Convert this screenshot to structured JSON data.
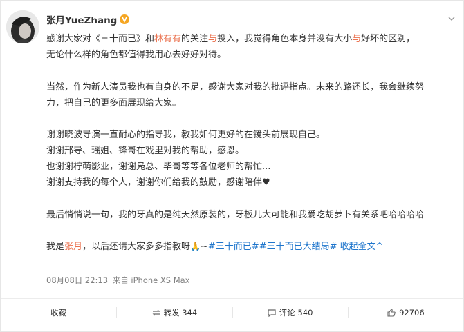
{
  "user": {
    "name": "张月YueZhang"
  },
  "post": {
    "line1": {
      "t1": "感谢大家对《三十而已》和",
      "name": "林有有",
      "t2": "的关注",
      "and": "与",
      "t3": "投入，我觉得角色本身并没有大小",
      "and2": "与",
      "t4": "好坏的区别，"
    },
    "line2": "无论什么样的角色都值得我用心去好好对待。",
    "line3": "当然，作为新人演员我也有自身的不足，感谢大家对我的批评指点。未来的路还长，我会继续努",
    "line4": "力，把自己的更多面展现给大家。",
    "line5": "谢谢晓波导演一直耐心的指导我，教我如何更好的在镜头前展现自己。",
    "line6": "谢谢邢导、瑶姐、锋哥在戏里对我的帮助，感恩。",
    "line7": "也谢谢柠萌影业，谢谢凫总、毕哥等等各位老师的帮忙...",
    "line8": "谢谢支持我的每个人，谢谢你们给我的鼓励，感谢陪伴",
    "line8_heart": "♥",
    "line9": "最后悄悄说一句，我的牙真的是纯天然原装的，牙板儿大可能和我爱吃胡萝卜有关系吧哈哈哈哈",
    "line10": {
      "t1": "我是",
      "name": "张月",
      "t2": "，以后还请大家多多指教呀",
      "pray": "🙏",
      "tilde": "~",
      "tag1": "#三十而已#",
      "tag2": "#三十而已大结局#",
      "expand": "收起全文",
      "expand_arrow": "^"
    }
  },
  "meta": {
    "date": "08月08日 22:13",
    "source": "来自 iPhone XS Max"
  },
  "actions": {
    "favorite": "收藏",
    "repost": "转发 344",
    "comment": "评论 540",
    "like": "92706"
  },
  "colors": {
    "accent": "#eb7350",
    "link": "#1e75cc",
    "badge": "#f5a623"
  },
  "icons": {
    "verified": "verified-badge-icon",
    "menu": "chevron-down-icon",
    "repost": "repost-icon",
    "comment": "comment-icon",
    "like": "thumbs-up-icon"
  }
}
